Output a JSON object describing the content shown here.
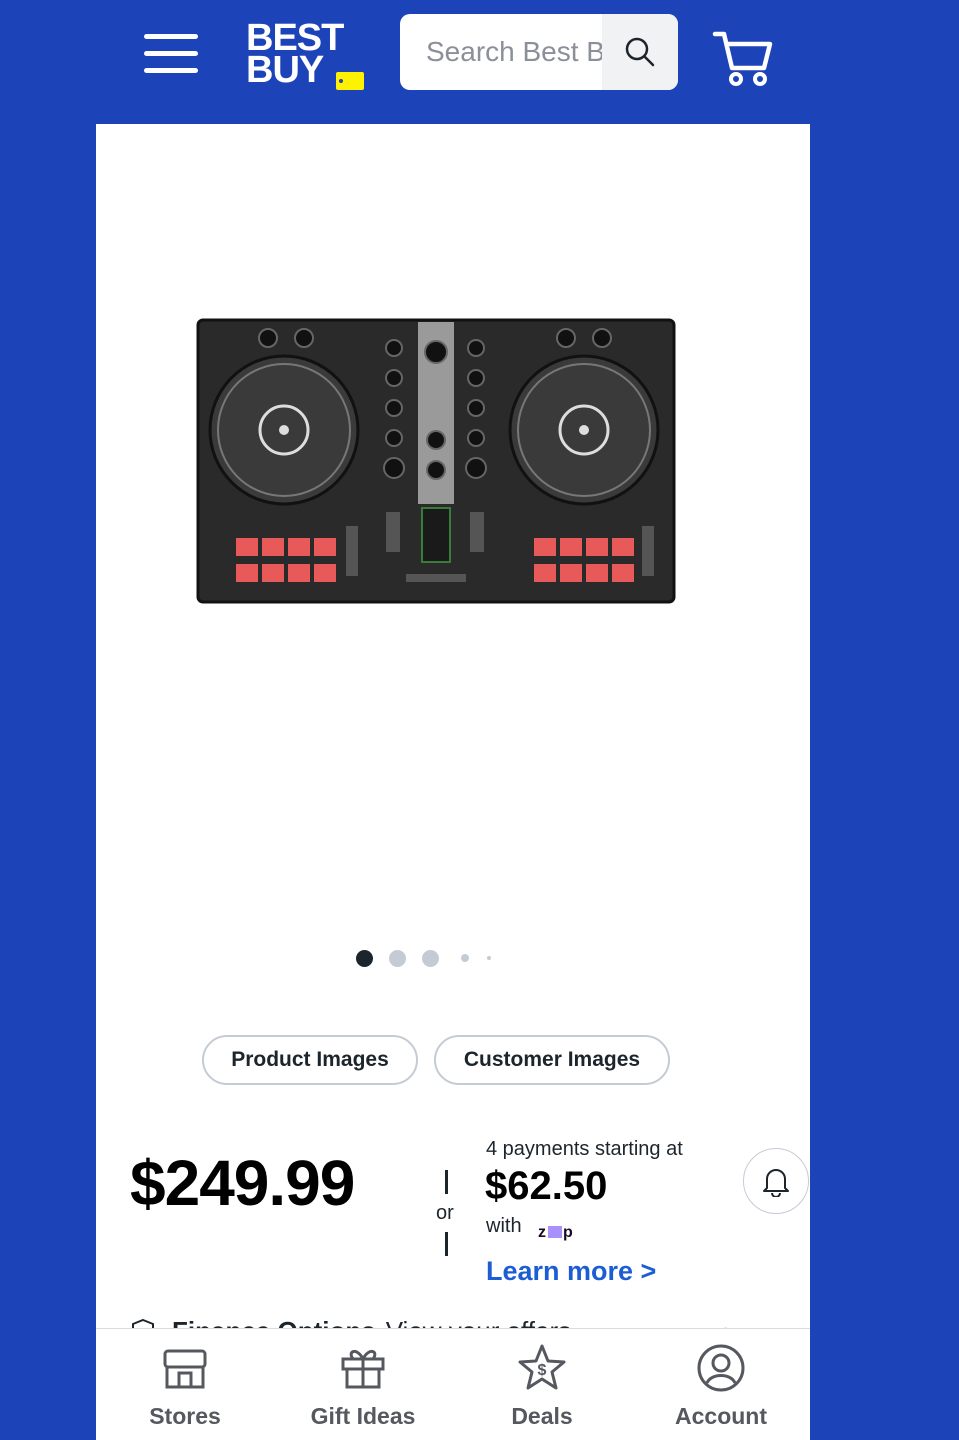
{
  "header": {
    "logo": "BEST BUY",
    "search_placeholder": "Search Best Buy",
    "icons": [
      "menu-icon",
      "search-icon",
      "cart-icon"
    ]
  },
  "gallery": {
    "image_alt": "DJ controller product image",
    "dot_count": 5,
    "active_dot": 1,
    "buttons": {
      "product_images": "Product Images",
      "customer_images": "Customer Images"
    }
  },
  "pricing": {
    "price": "$249.99",
    "or": "or",
    "payments_line": "4 payments starting at",
    "payment_amount": "$62.50",
    "with": "with",
    "provider": "zip",
    "learn_more": "Learn more >"
  },
  "finance": {
    "title": "Finance Options",
    "offer": "View your offers",
    "chevron": "›"
  },
  "bottom_nav": {
    "items": [
      {
        "label": "Stores",
        "icon": "store-icon"
      },
      {
        "label": "Gift Ideas",
        "icon": "gift-icon"
      },
      {
        "label": "Deals",
        "icon": "deals-icon"
      },
      {
        "label": "Account",
        "icon": "account-icon"
      }
    ]
  },
  "colors": {
    "brand_blue": "#1d43b9",
    "brand_yellow": "#fff200",
    "link_blue": "#1d5dd4",
    "text_dark": "#1d252c"
  }
}
